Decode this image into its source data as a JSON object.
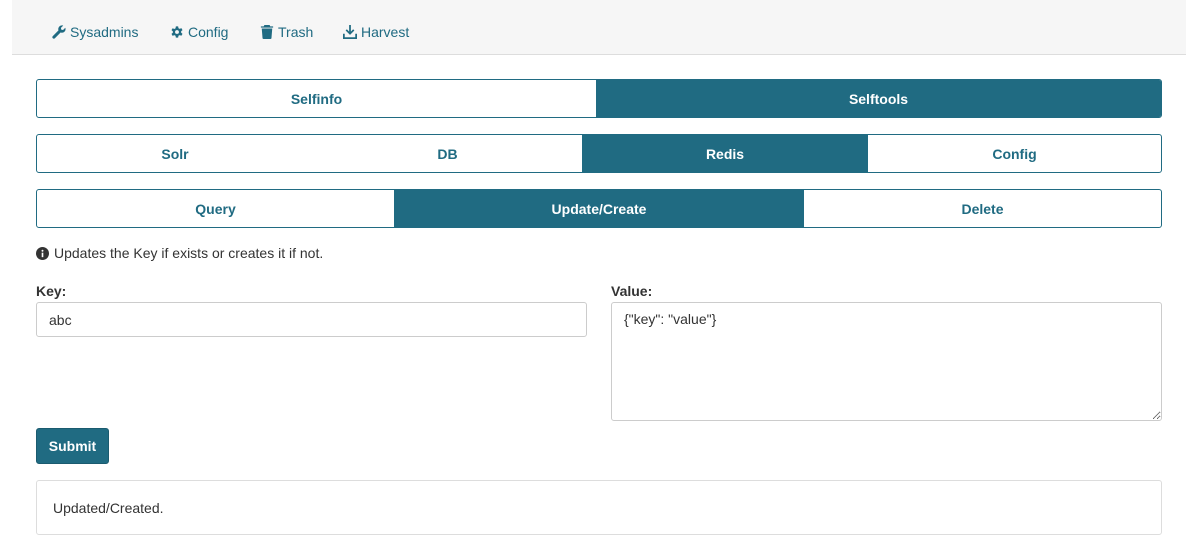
{
  "colors": {
    "accent": "#206b82",
    "border": "#dddddd",
    "navbar_bg": "#f6f6f6"
  },
  "topnav": {
    "items": [
      {
        "label": "Sysadmins",
        "icon": "wrench-icon"
      },
      {
        "label": "Config",
        "icon": "gear-icon"
      },
      {
        "label": "Trash",
        "icon": "trash-icon"
      },
      {
        "label": "Harvest",
        "icon": "download-icon"
      }
    ]
  },
  "tabs_level1": {
    "items": [
      "Selfinfo",
      "Selftools"
    ],
    "active": "Selftools"
  },
  "tabs_level2": {
    "items": [
      "Solr",
      "DB",
      "Redis",
      "Config"
    ],
    "active": "Redis"
  },
  "tabs_level3": {
    "items": [
      "Query",
      "Update/Create",
      "Delete"
    ],
    "active": "Update/Create"
  },
  "info": {
    "icon": "info-circle-icon",
    "text": "Updates the Key if exists or creates it if not."
  },
  "form": {
    "key_label": "Key:",
    "key_value": "abc",
    "value_label": "Value:",
    "value_value": "{\"key\": \"value\"}",
    "submit_label": "Submit"
  },
  "result": {
    "text": "Updated/Created."
  }
}
